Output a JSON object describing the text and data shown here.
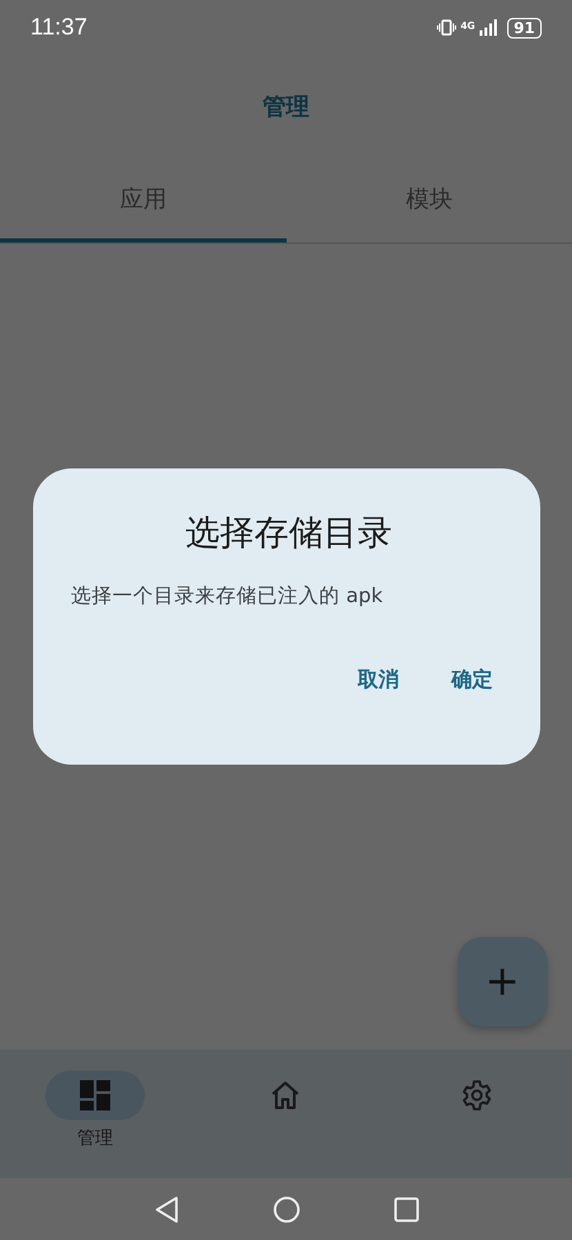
{
  "status_bar": {
    "time": "11:37",
    "network": "4G",
    "battery": "91"
  },
  "title": "管理",
  "tabs": [
    {
      "label": "应用",
      "selected": true
    },
    {
      "label": "模块",
      "selected": false
    }
  ],
  "dialog": {
    "title": "选择存储目录",
    "message": "选择一个目录来存储已注入的 apk",
    "buttons": [
      "取消",
      "确定"
    ]
  },
  "fab": {
    "icon": "+"
  },
  "bottom_nav": [
    {
      "kind": "dashboard",
      "label": "管理",
      "selected": true
    },
    {
      "kind": "home",
      "selected": false
    },
    {
      "kind": "settings",
      "selected": false
    }
  ]
}
